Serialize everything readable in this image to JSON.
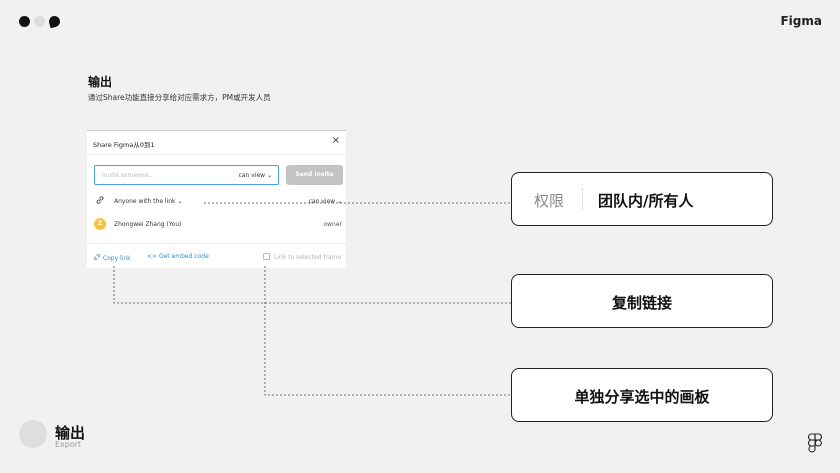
{
  "brand": "Figma",
  "heading": "输出",
  "subheading": "通过Share功能直接分享给对应需求方，PM或开发人员",
  "dialog": {
    "title": "Share Figma从0到1",
    "close_icon": "×",
    "invite_placeholder": "Invite someone...",
    "invite_permission": "can view ⌄",
    "send_label": "Send invite",
    "link_access": "Anyone with the link ⌄",
    "link_permission": "can view ⌄",
    "user": {
      "avatar_initial": "Z",
      "name": "Zhongwei Zhang (You)",
      "role": "owner"
    },
    "copy_link": "Copy link",
    "embed_code": "<> Get embed code",
    "selected_frame": "Link to selected frame"
  },
  "callouts": {
    "permission": {
      "tag": "权限",
      "text": "团队内/所有人"
    },
    "copy": {
      "text": "复制链接"
    },
    "frame": {
      "text": "单独分享选中的画板"
    }
  },
  "badge": {
    "title": "输出",
    "subtitle": "Export"
  },
  "icons": {
    "link": "link-icon",
    "close": "close-icon",
    "figma": "figma-logo-icon"
  },
  "colors": {
    "accent": "#2d8fd6",
    "avatar": "#f6c33b",
    "send_disabled": "#c3c3c3"
  }
}
